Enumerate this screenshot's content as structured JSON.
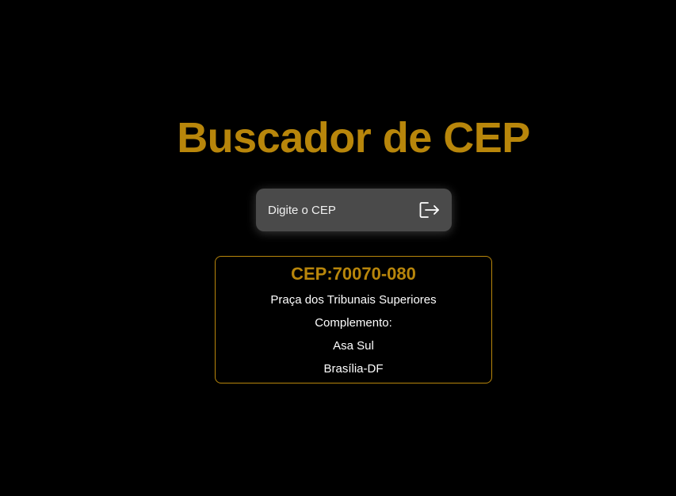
{
  "header": {
    "title": "Buscador de CEP"
  },
  "search": {
    "placeholder": "Digite o CEP",
    "value": "",
    "button_icon": "exit-arrow-icon"
  },
  "result": {
    "cep_label": "CEP:70070-080",
    "logradouro": "Praça dos Tribunais Superiores",
    "complemento": "Complemento:",
    "bairro": "Asa Sul",
    "cidade_uf": "Brasília-DF"
  },
  "colors": {
    "accent": "#b8860b",
    "background": "#000000",
    "input_bg": "#4a4a4a",
    "text": "#ffffff"
  }
}
